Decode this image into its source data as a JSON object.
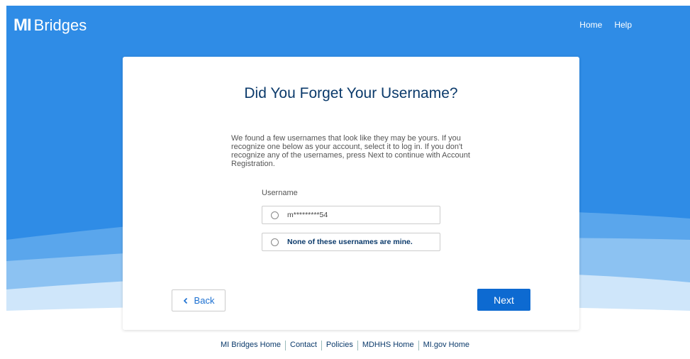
{
  "header": {
    "logo_mark": "MI",
    "logo_text": "Bridges",
    "nav": {
      "home": "Home",
      "help": "Help"
    }
  },
  "card": {
    "title": "Did You Forget Your Username?",
    "description": "We found a few usernames that look like they may be yours. If you recognize one below as your account, select it to log in. If you don't recognize any of the usernames, press Next to continue with Account Registration.",
    "field_label": "Username",
    "options": [
      {
        "label": "m*********54"
      },
      {
        "label": "None of these usernames are mine."
      }
    ],
    "back_label": "Back",
    "back_icon": "chevron-left-icon",
    "next_label": "Next"
  },
  "footer": {
    "links": [
      "MI Bridges Home",
      "Contact",
      "Policies",
      "MDHHS Home",
      "MI.gov Home"
    ]
  },
  "colors": {
    "primary": "#0d6ad1",
    "header_bg": "#2f8ce6",
    "title": "#0b3a6b"
  }
}
